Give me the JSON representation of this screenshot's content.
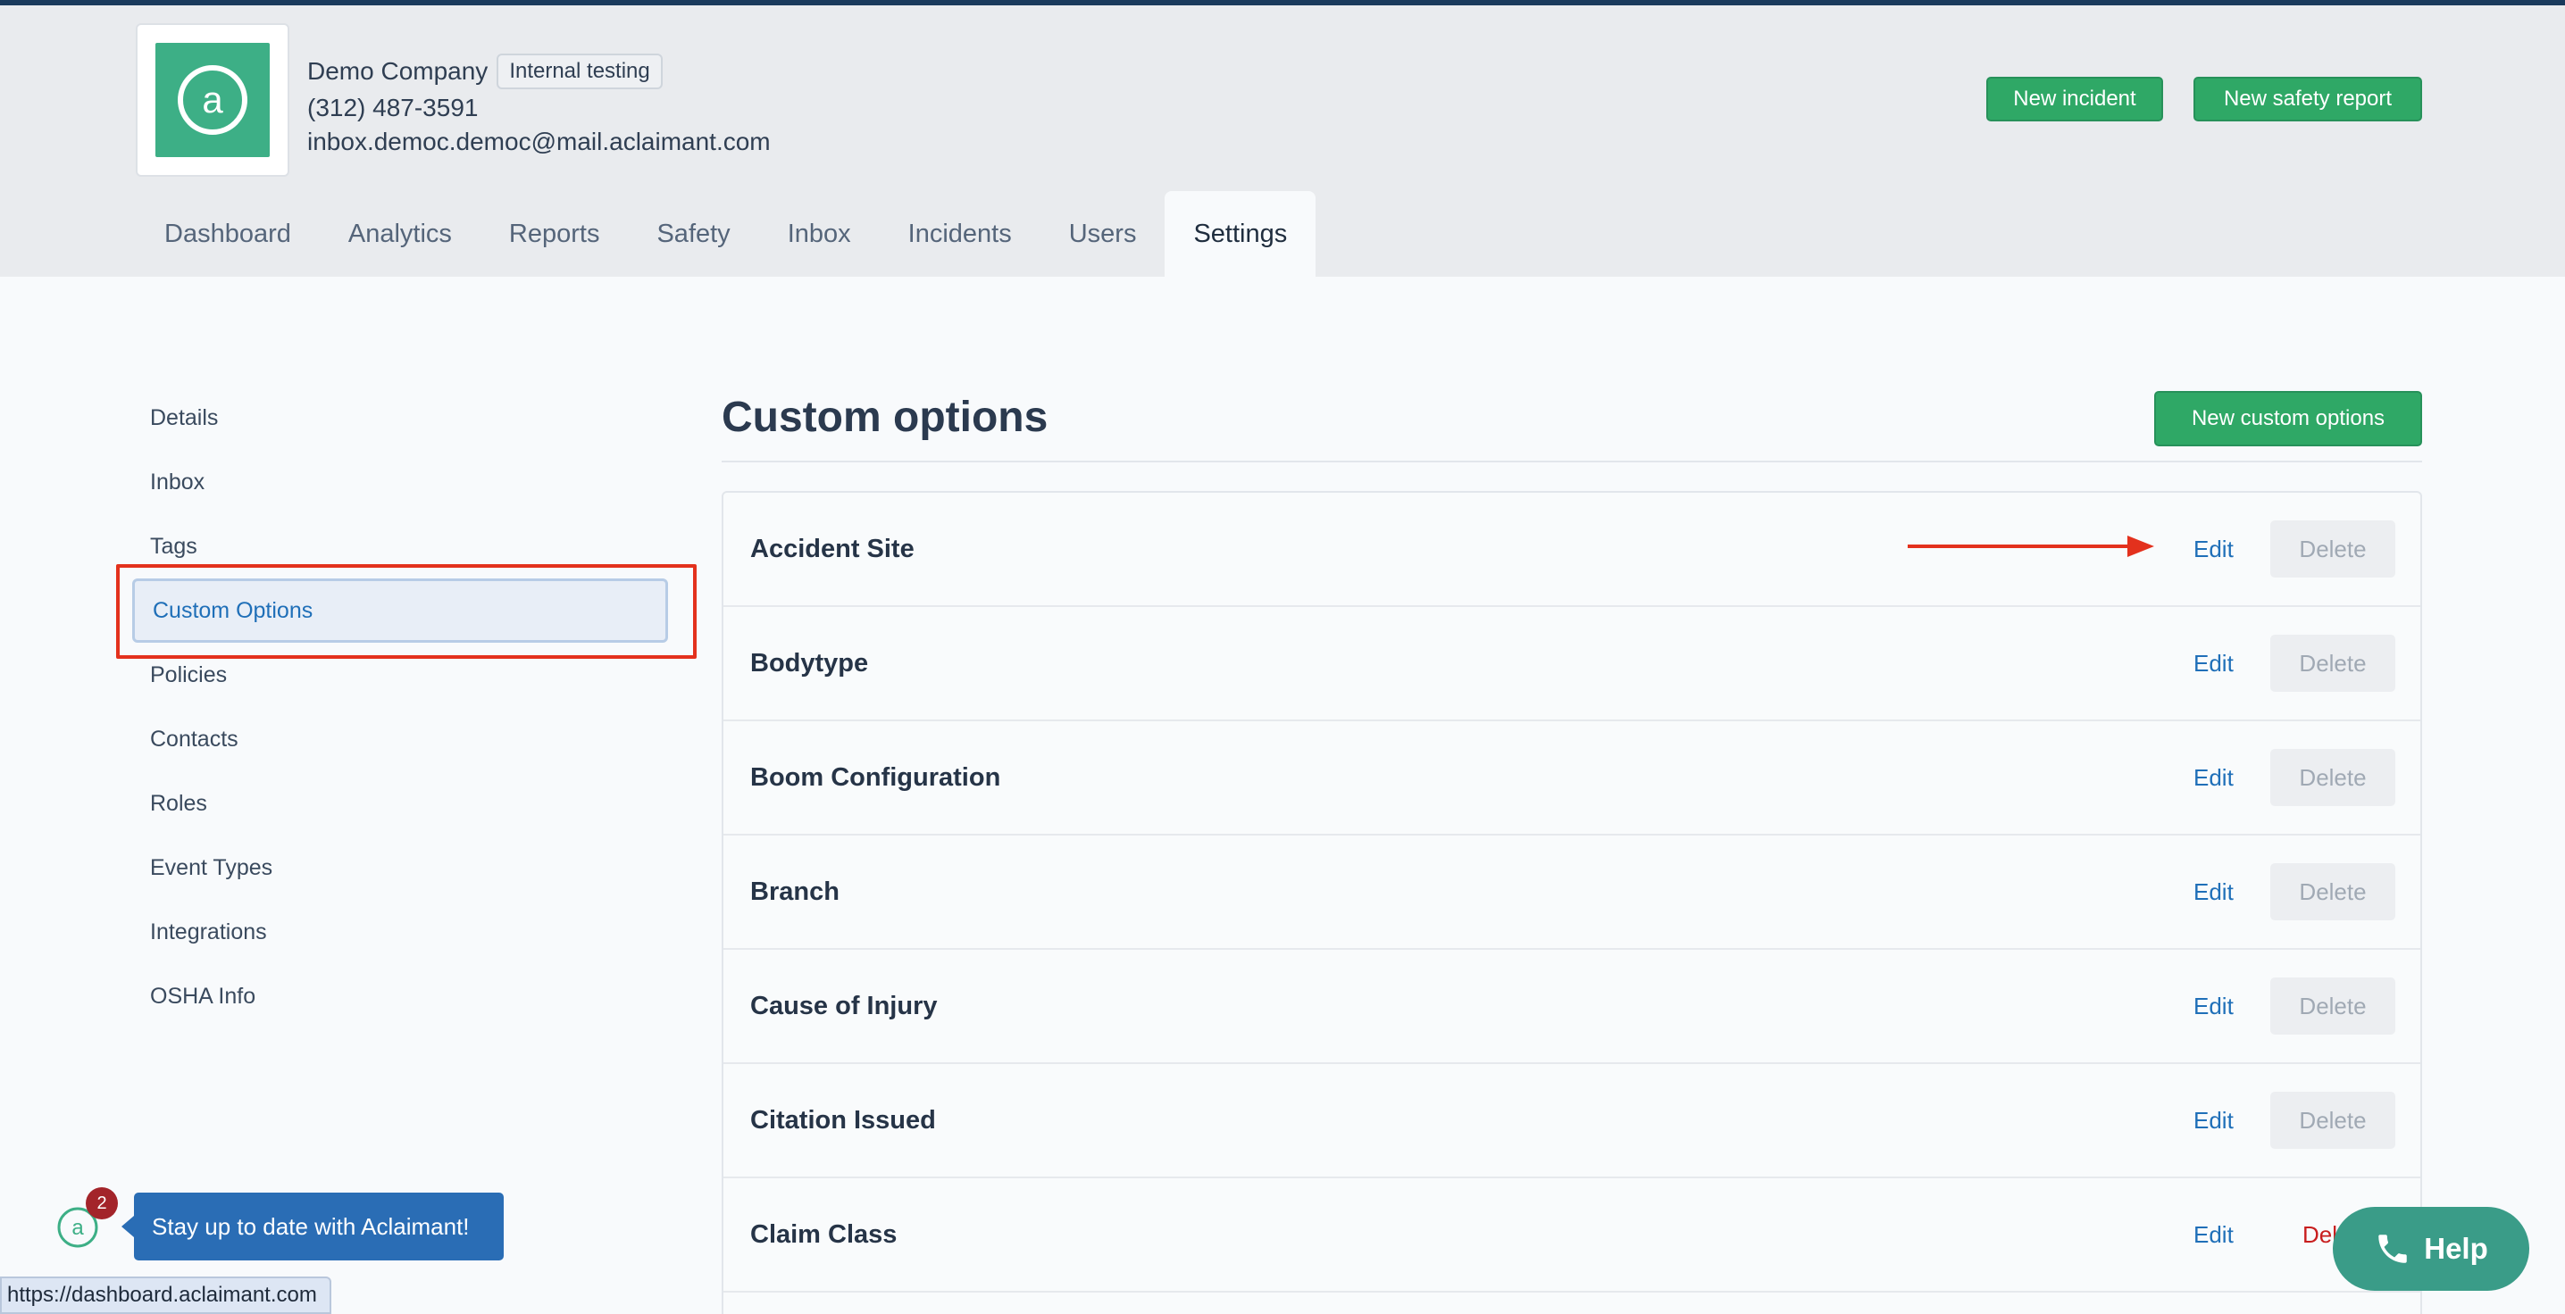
{
  "company": {
    "name": "Demo Company",
    "badge": "Internal testing",
    "phone": "(312) 487-3591",
    "email": "inbox.democ.democ@mail.aclaimant.com"
  },
  "header_actions": {
    "new_incident": "New incident",
    "new_safety_report": "New safety report"
  },
  "nav": {
    "tabs": [
      "Dashboard",
      "Analytics",
      "Reports",
      "Safety",
      "Inbox",
      "Incidents",
      "Users",
      "Settings"
    ],
    "active": "Settings"
  },
  "sidebar": {
    "items": [
      "Details",
      "Inbox",
      "Tags",
      "Custom Options",
      "Policies",
      "Contacts",
      "Roles",
      "Event Types",
      "Integrations",
      "OSHA Info"
    ],
    "active": "Custom Options"
  },
  "main": {
    "title": "Custom options",
    "new_button": "New custom options",
    "edit_label": "Edit",
    "delete_label": "Delete",
    "delete_partial_label": "Dele",
    "rows": [
      "Accident Site",
      "Bodytype",
      "Boom Configuration",
      "Branch",
      "Cause of Injury",
      "Citation Issued",
      "Claim Class"
    ]
  },
  "notification": {
    "count": "2",
    "message": "Stay up to date with Aclaimant!"
  },
  "status_bar": {
    "url": "https://dashboard.aclaimant.com"
  },
  "help": {
    "label": "Help"
  },
  "colors": {
    "brand_green": "#3daf86",
    "button_green": "#2fa866",
    "link_blue": "#1f6fb8",
    "annotation_red": "#e3311d"
  }
}
